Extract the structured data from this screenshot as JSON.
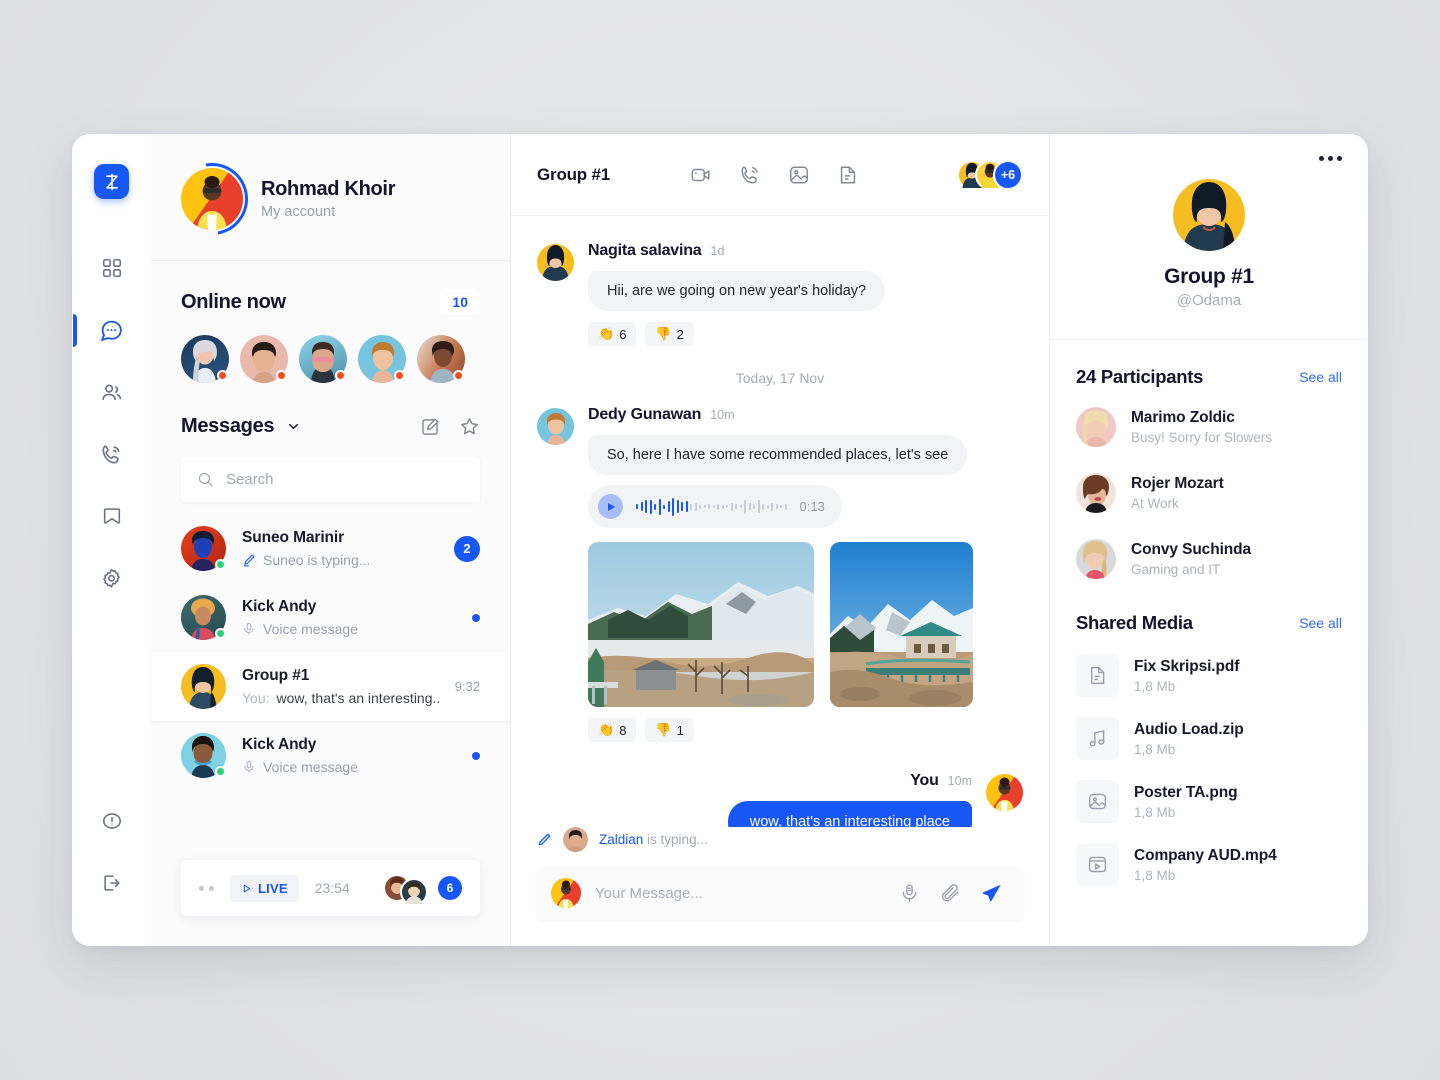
{
  "rail": {
    "logo_label": "Z",
    "items": [
      {
        "name": "dashboard",
        "icon": "grid-icon",
        "active": false
      },
      {
        "name": "messages",
        "icon": "chat-bubble-icon",
        "active": true
      },
      {
        "name": "contacts",
        "icon": "people-icon",
        "active": false
      },
      {
        "name": "calls",
        "icon": "phone-icon",
        "active": false
      },
      {
        "name": "saved",
        "icon": "bookmark-icon",
        "active": false
      },
      {
        "name": "settings",
        "icon": "gear-icon",
        "active": false
      }
    ],
    "bottom_items": [
      {
        "name": "help",
        "icon": "info-circle-icon"
      },
      {
        "name": "logout",
        "icon": "logout-icon"
      }
    ]
  },
  "profile": {
    "name": "Rohmad Khoir",
    "subtitle": "My account"
  },
  "online": {
    "title": "Online now",
    "count": "10",
    "avatars": [
      {
        "name": "online-user-1"
      },
      {
        "name": "online-user-2"
      },
      {
        "name": "online-user-3"
      },
      {
        "name": "online-user-4"
      },
      {
        "name": "online-user-5"
      }
    ]
  },
  "messages_panel": {
    "title": "Messages",
    "search_placeholder": "Search",
    "compose_icon": "edit-square-icon",
    "star_icon": "star-icon",
    "chats": [
      {
        "name": "Suneo Marinir",
        "preview": "Suneo is typing...",
        "preview_icon": "pencil-icon",
        "badge": "2",
        "badge_type": "number",
        "time": "",
        "active": false,
        "online": true
      },
      {
        "name": "Kick Andy",
        "preview": "Voice message",
        "preview_icon": "mic-icon",
        "badge": "",
        "badge_type": "dot",
        "time": "",
        "active": false,
        "online": true
      },
      {
        "name": "Group #1",
        "preview_prefix": "You:",
        "preview": "wow, that's an interesting...",
        "preview_icon": "",
        "badge": "",
        "badge_type": "none",
        "time": "9:32",
        "active": true,
        "online": false
      },
      {
        "name": "Kick Andy",
        "preview": "Voice message",
        "preview_icon": "mic-icon",
        "badge": "",
        "badge_type": "dot",
        "time": "",
        "active": false,
        "online": true
      }
    ]
  },
  "live_bar": {
    "label": "LIVE",
    "time": "23:54",
    "count": "6"
  },
  "chat": {
    "title": "Group #1",
    "header_icons": [
      {
        "name": "video-camera-icon"
      },
      {
        "name": "phone-call-icon"
      },
      {
        "name": "image-icon"
      },
      {
        "name": "document-icon"
      }
    ],
    "members_overflow": "+6",
    "day_separator": "Today, 17 Nov",
    "messages": [
      {
        "author": "Nagita salavina",
        "time": "1d",
        "text": "Hii, are we going on new year's holiday?",
        "reactions": [
          {
            "emoji": "👏",
            "count": "6"
          },
          {
            "emoji": "👎",
            "count": "2"
          }
        ]
      },
      {
        "author": "Dedy Gunawan",
        "time": "10m",
        "text": "So, here I have some recommended places, let's see",
        "voice_duration": "0:13",
        "reactions": [
          {
            "emoji": "👏",
            "count": "8"
          },
          {
            "emoji": "👎",
            "count": "1"
          }
        ]
      }
    ],
    "own_message": {
      "author": "You",
      "time": "10m",
      "text": "wow, that's an interesting place"
    },
    "typing": {
      "user": "Zaldian",
      "suffix": "is typing..."
    },
    "composer": {
      "placeholder": "Your Message...",
      "icons": [
        {
          "name": "mic-icon"
        },
        {
          "name": "paperclip-icon"
        },
        {
          "name": "send-icon"
        }
      ]
    }
  },
  "right_panel": {
    "menu_icon": "more-horizontal-icon",
    "group_name": "Group #1",
    "group_handle": "@Odama",
    "participants_title": "24 Participants",
    "participants_see_all": "See all",
    "participants": [
      {
        "name": "Marimo Zoldic",
        "status": "Busy! Sorry for Slowers"
      },
      {
        "name": "Rojer Mozart",
        "status": "At Work"
      },
      {
        "name": "Convy Suchinda",
        "status": "Gaming and IT"
      }
    ],
    "media_title": "Shared Media",
    "media_see_all": "See all",
    "media": [
      {
        "name": "Fix Skripsi.pdf",
        "size": "1,8 Mb",
        "icon": "document-icon"
      },
      {
        "name": "Audio Load.zip",
        "size": "1,8 Mb",
        "icon": "music-note-icon"
      },
      {
        "name": "Poster TA.png",
        "size": "1,8 Mb",
        "icon": "image-icon"
      },
      {
        "name": "Company AUD.mp4",
        "size": "1,8 Mb",
        "icon": "video-play-icon"
      }
    ]
  },
  "colors": {
    "accent": "#1757f5",
    "online_dot": "#2ecf7a",
    "busy_dot": "#f24e1e",
    "text_dark": "#14142b",
    "text_muted": "#9aa0ab"
  }
}
